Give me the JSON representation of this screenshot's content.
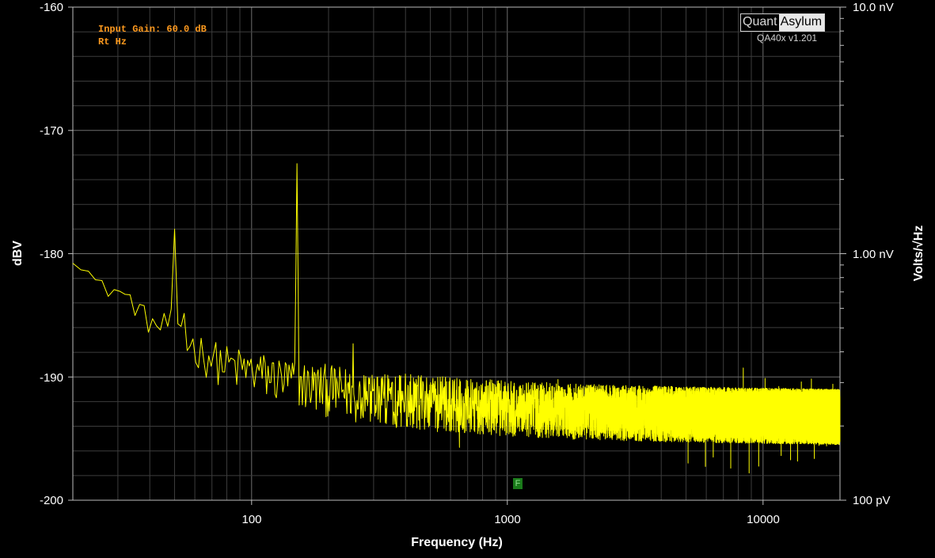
{
  "chart_data": {
    "type": "line",
    "xlabel": "Frequency (Hz)",
    "ylabel": "dBV",
    "y2label": "Volts/√Hz",
    "xscale": "log",
    "xlim": [
      20,
      20000
    ],
    "ylim": [
      -200,
      -160
    ],
    "grid": true,
    "x_ticks": [
      "100",
      "1000",
      "10000"
    ],
    "y_ticks": [
      "-160",
      "-170",
      "-180",
      "-190",
      "-200"
    ],
    "y2_ticks": [
      "10.0 nV",
      "1.00 nV",
      "100 pV"
    ],
    "annotations": [
      "Input Gain: 60.0 dB",
      "Rt Hz"
    ],
    "line_color": "#ffff00",
    "noise_model": {
      "anchors_hz": [
        20,
        22,
        25,
        30,
        35,
        40,
        45,
        49,
        55,
        60,
        70,
        80,
        100,
        150,
        200,
        300,
        500,
        1000,
        2000,
        5000,
        10000,
        20000
      ],
      "anchors_dbv": [
        -180.2,
        -180.9,
        -182.5,
        -183.0,
        -184.0,
        -185.5,
        -186.0,
        -185.3,
        -187.0,
        -187.4,
        -188.3,
        -188.9,
        -189.4,
        -190.3,
        -190.8,
        -191.4,
        -191.9,
        -192.3,
        -192.6,
        -192.8,
        -192.9,
        -193.0
      ],
      "spread_low_db": [
        0.6,
        0.6,
        0.8,
        1.0,
        1.1,
        1.2,
        1.4,
        1.6,
        1.8,
        2.0,
        2.1,
        2.2,
        2.3,
        2.4,
        2.5,
        2.5,
        2.5,
        2.5,
        2.5,
        2.5,
        2.5,
        2.5
      ],
      "spread_high_db": [
        0.4,
        0.4,
        0.5,
        0.6,
        0.7,
        0.8,
        0.9,
        1.0,
        1.1,
        1.2,
        1.3,
        1.5,
        1.6,
        1.7,
        1.8,
        1.9,
        2.0,
        2.0,
        2.0,
        2.0,
        2.0,
        2.0
      ]
    },
    "peaks": [
      {
        "freq_hz": 50,
        "dbv": -178.0
      },
      {
        "freq_hz": 150,
        "dbv": -172.7
      },
      {
        "freq_hz": 250,
        "dbv": -187.3
      }
    ],
    "marker_label": "F",
    "marker_freq_hz": 1100,
    "marker_dbv": -197.0
  },
  "logo": {
    "quant": "Quant",
    "asylum": "Asylum",
    "version": "QA40x v1.201"
  }
}
